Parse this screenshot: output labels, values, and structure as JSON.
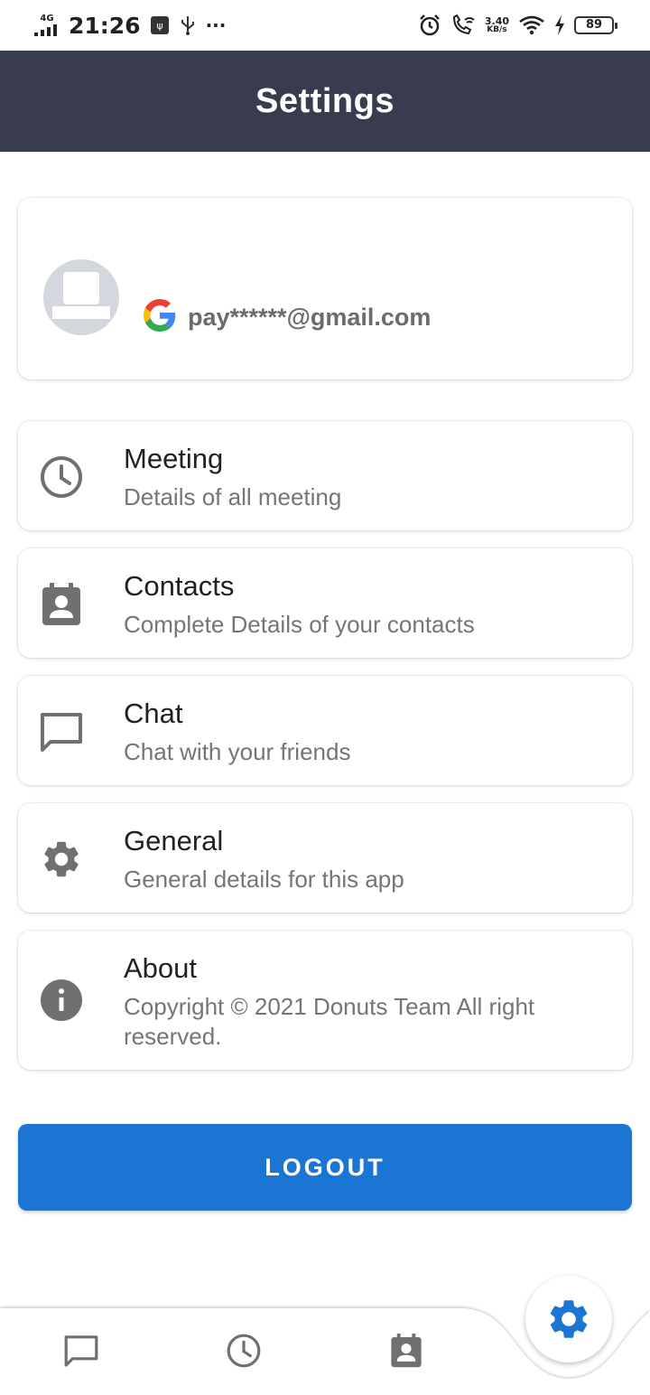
{
  "status_bar": {
    "network": "4G",
    "time": "21:26",
    "dots": "···",
    "speed_value": "3.40",
    "speed_unit": "KB/s",
    "battery": "89"
  },
  "app_bar": {
    "title": "Settings"
  },
  "profile": {
    "email": "pay******@gmail.com"
  },
  "menu": [
    {
      "title": "Meeting",
      "subtitle": "Details of all meeting",
      "icon": "clock-icon"
    },
    {
      "title": "Contacts",
      "subtitle": "Complete Details of your contacts",
      "icon": "contact-calendar-icon"
    },
    {
      "title": "Chat",
      "subtitle": "Chat with your friends",
      "icon": "chat-bubble-icon"
    },
    {
      "title": "General",
      "subtitle": "General details for this app",
      "icon": "gear-icon"
    },
    {
      "title": "About",
      "subtitle": "Copyright © 2021 Donuts Team All right reserved.",
      "icon": "info-icon"
    }
  ],
  "logout": {
    "label": "LOGOUT"
  },
  "bottom_nav": {
    "items": [
      "chat-bubble-icon",
      "clock-icon",
      "contact-calendar-icon"
    ],
    "active": "gear-icon"
  },
  "colors": {
    "app_bar": "#393b4f",
    "accent": "#1a76d2",
    "icon": "#707070"
  }
}
